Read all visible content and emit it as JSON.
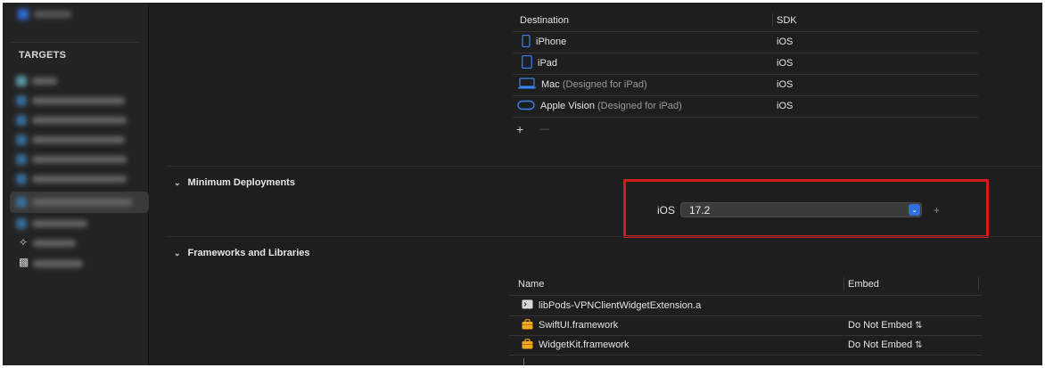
{
  "sidebar": {
    "targets_header": "TARGETS"
  },
  "destinations": {
    "headers": {
      "destination": "Destination",
      "sdk": "SDK"
    },
    "rows": [
      {
        "name": "iPhone",
        "suffix": "",
        "sdk": "iOS",
        "icon": "iphone-icon"
      },
      {
        "name": "iPad",
        "suffix": "",
        "sdk": "iOS",
        "icon": "ipad-icon"
      },
      {
        "name": "Mac",
        "suffix": "(Designed for iPad)",
        "sdk": "iOS",
        "icon": "mac-icon"
      },
      {
        "name": "Apple Vision",
        "suffix": "(Designed for iPad)",
        "sdk": "iOS",
        "icon": "vision-icon"
      }
    ],
    "add": "+",
    "remove": "—"
  },
  "min_deploy": {
    "title": "Minimum Deployments",
    "platform": "iOS",
    "version": "17.2",
    "add": "+"
  },
  "frameworks": {
    "title": "Frameworks and Libraries",
    "headers": {
      "name": "Name",
      "embed": "Embed"
    },
    "rows": [
      {
        "name": "libPods-VPNClientWidgetExtension.a",
        "embed": "",
        "icon": "library-icon"
      },
      {
        "name": "SwiftUI.framework",
        "embed": "Do Not Embed",
        "icon": "framework-icon"
      },
      {
        "name": "WidgetKit.framework",
        "embed": "Do Not Embed",
        "icon": "framework-icon"
      }
    ]
  },
  "colors": {
    "accent": "#2f6fe0",
    "highlight": "#d11c1c",
    "framework_icon": "#f0a81e"
  }
}
